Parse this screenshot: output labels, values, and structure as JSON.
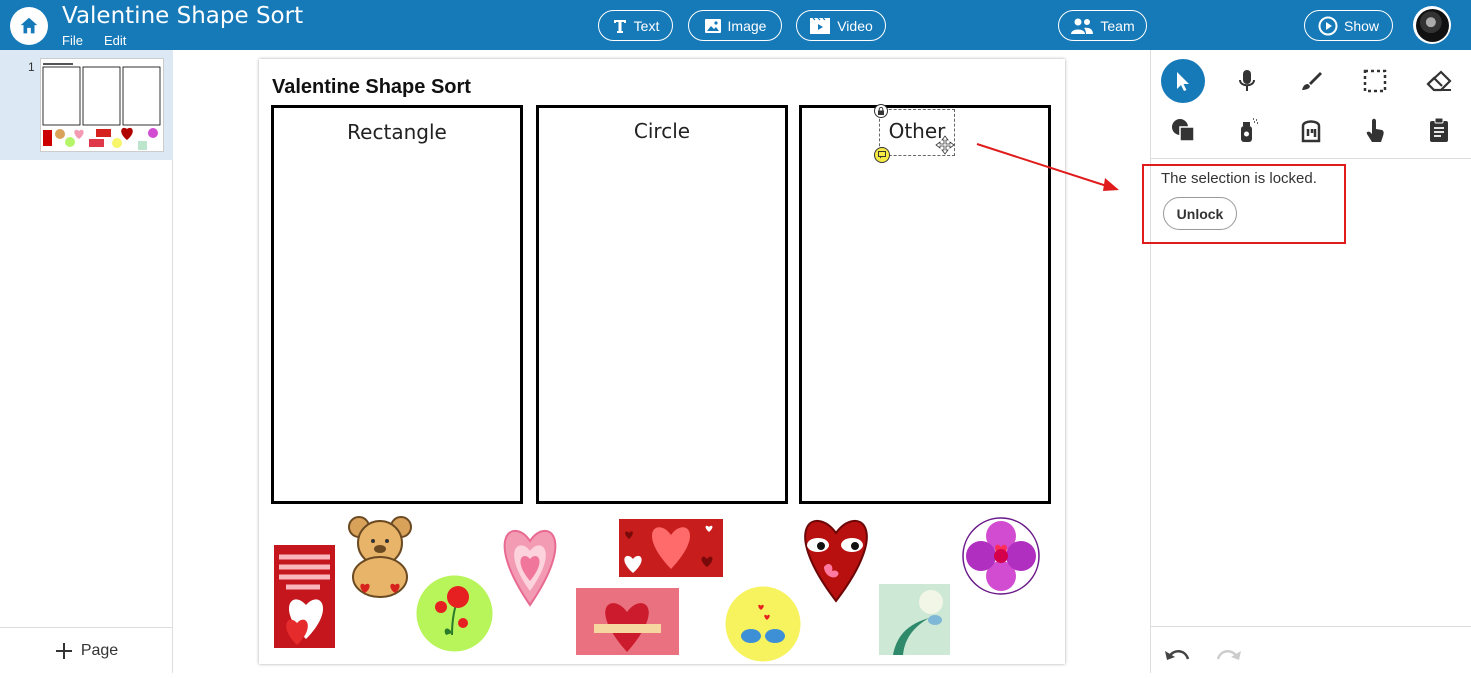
{
  "header": {
    "title": "Valentine Shape Sort",
    "menu": {
      "file": "File",
      "edit": "Edit"
    },
    "buttons": {
      "text": "Text",
      "image": "Image",
      "video": "Video",
      "team": "Team",
      "show": "Show"
    }
  },
  "pages_panel": {
    "pages": [
      {
        "number": "1"
      }
    ],
    "add_page_label": "Page"
  },
  "canvas": {
    "page_title": "Valentine Shape Sort",
    "boxes": [
      {
        "label": "Rectangle"
      },
      {
        "label": "Circle"
      },
      {
        "label": "Other"
      }
    ],
    "stickers": [
      "happy-valentines-card",
      "teddy-bear",
      "flower-circle",
      "plaid-heart",
      "hearts-card",
      "happy-valentines-day-banner",
      "heart-face",
      "bird-circle",
      "flower-mandala",
      "bird-on-branch"
    ]
  },
  "tools_panel": {
    "tools_row1": [
      "pointer-icon",
      "microphone-icon",
      "brush-icon",
      "selection-icon",
      "eraser-icon"
    ],
    "tools_row2": [
      "shapes-icon",
      "spray-icon",
      "paint-bucket-icon",
      "touch-icon",
      "clipboard-icon"
    ],
    "lock_message": "The selection is locked.",
    "unlock_label": "Unlock"
  },
  "colors": {
    "accent": "#1679b8",
    "highlight": "#e01b1b"
  }
}
